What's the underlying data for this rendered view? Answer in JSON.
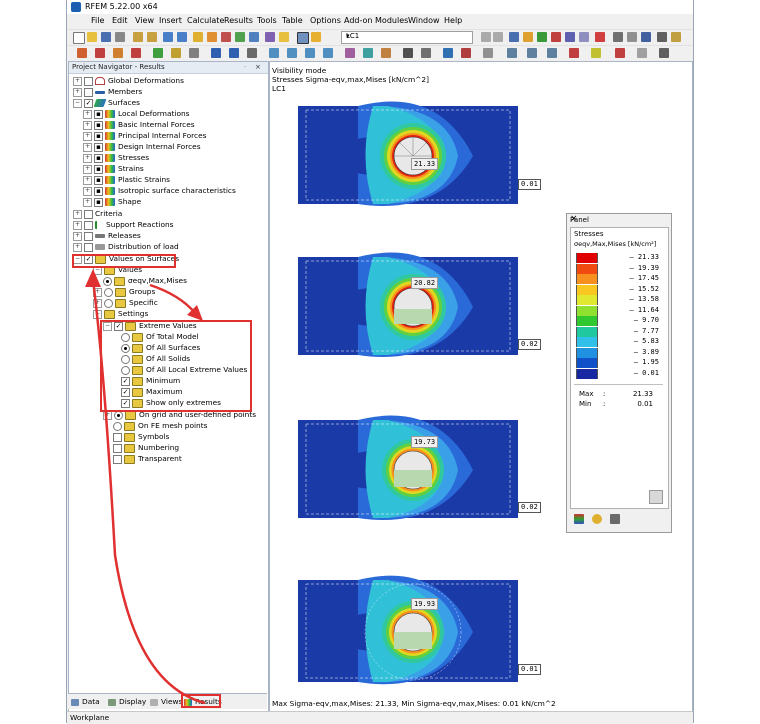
{
  "window": {
    "title": "RFEM 5.22.00 x64"
  },
  "menu": [
    "File",
    "Edit",
    "View",
    "Insert",
    "Calculate",
    "Results",
    "Tools",
    "Table",
    "Options",
    "Add-on Modules",
    "Window",
    "Help"
  ],
  "toolbar": {
    "load_case": "LC1"
  },
  "navigator": {
    "title": "Project Navigator - Results",
    "items": [
      {
        "label": "Global Deformations"
      },
      {
        "label": "Members"
      },
      {
        "label": "Surfaces"
      },
      {
        "label": "Local Deformations"
      },
      {
        "label": "Basic Internal Forces"
      },
      {
        "label": "Principal Internal Forces"
      },
      {
        "label": "Design Internal Forces"
      },
      {
        "label": "Stresses"
      },
      {
        "label": "Strains"
      },
      {
        "label": "Plastic Strains"
      },
      {
        "label": "Isotropic surface characteristics"
      },
      {
        "label": "Shape"
      },
      {
        "label": "Criteria"
      },
      {
        "label": "Support Reactions"
      },
      {
        "label": "Releases"
      },
      {
        "label": "Distribution of load"
      },
      {
        "label": "Values on Surfaces"
      },
      {
        "label": "Values"
      },
      {
        "label": "σeqv,Max,Mises"
      },
      {
        "label": "Groups"
      },
      {
        "label": "Specific"
      },
      {
        "label": "Settings"
      },
      {
        "label": "Extreme Values"
      },
      {
        "label": "Of Total Model"
      },
      {
        "label": "Of All Surfaces"
      },
      {
        "label": "Of All Solids"
      },
      {
        "label": "Of All Local Extreme Values"
      },
      {
        "label": "Minimum"
      },
      {
        "label": "Maximum"
      },
      {
        "label": "Show only extremes"
      },
      {
        "label": "On grid and user-defined points"
      },
      {
        "label": "On FE mesh points"
      },
      {
        "label": "Symbols"
      },
      {
        "label": "Numbering"
      },
      {
        "label": "Transparent"
      }
    ],
    "tabs": [
      "Data",
      "Display",
      "Views",
      "Results"
    ]
  },
  "viewport": {
    "mode": "Visibility mode",
    "result": "Stresses Sigma-eqv,max,Mises [kN/cm^2]",
    "load_case": "LC1",
    "plots": [
      {
        "max_label": "21.33",
        "edge_label": "0.01"
      },
      {
        "max_label": "20.82",
        "edge_label": "0.02"
      },
      {
        "max_label": "19.73",
        "edge_label": "0.02"
      },
      {
        "max_label": "19.93",
        "edge_label": "0.01"
      }
    ],
    "summary": "Max Sigma-eqv,max,Mises: 21.33, Min Sigma-eqv,max,Mises: 0.01 kN/cm^2"
  },
  "panel": {
    "title": "Panel",
    "section": "Stresses",
    "quantity": "σeqv,Max,Mises [kN/cm²]",
    "legend": [
      {
        "value": "21.33",
        "color": "#e00000"
      },
      {
        "value": "19.39",
        "color": "#f04a10"
      },
      {
        "value": "17.45",
        "color": "#f89020"
      },
      {
        "value": "15.52",
        "color": "#f8c820"
      },
      {
        "value": "13.58",
        "color": "#e0e830"
      },
      {
        "value": "11.64",
        "color": "#90e030"
      },
      {
        "value": "9.70",
        "color": "#30c830"
      },
      {
        "value": "7.77",
        "color": "#20c8a0"
      },
      {
        "value": "5.83",
        "color": "#30c0e8"
      },
      {
        "value": "3.89",
        "color": "#2090e0"
      },
      {
        "value": "1.95",
        "color": "#1050c8"
      },
      {
        "value": "0.01",
        "color": "#1828a0"
      }
    ],
    "max_label": "Max",
    "max_value": "21.33",
    "min_label": "Min",
    "min_value": "0.01"
  },
  "statusbar": {
    "text": "Workplane"
  }
}
